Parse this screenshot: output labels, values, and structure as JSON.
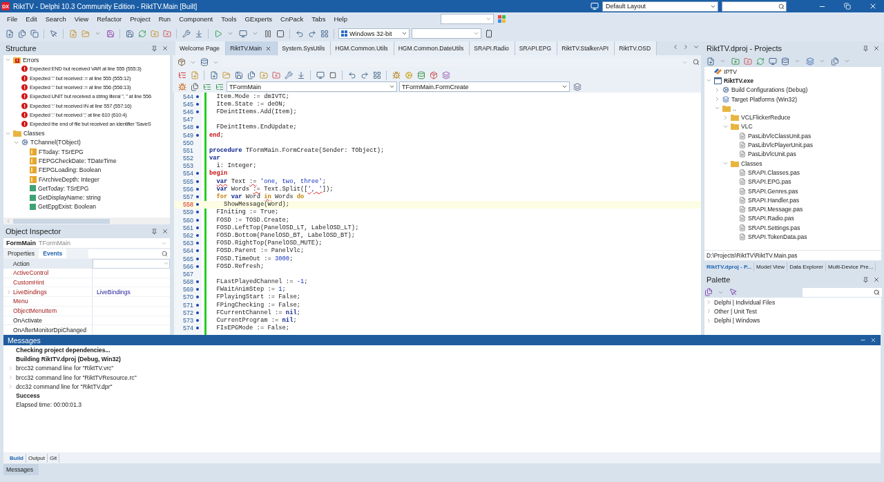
{
  "window": {
    "logo": "DX",
    "title": "RiktTV - Delphi 10.3 Community Edition - RiktTV.Main [Built]",
    "layout": "Default Layout"
  },
  "menu": [
    "File",
    "Edit",
    "Search",
    "View",
    "Refactor",
    "Project",
    "Run",
    "Component",
    "Tools",
    "GExperts",
    "CnPack",
    "Tabs",
    "Help"
  ],
  "toolbar": {
    "platform": "Windows 32-bit"
  },
  "structure": {
    "title": "Structure",
    "tree": [
      {
        "label": "Errors",
        "kind": "error-folder",
        "expanded": true,
        "children": [
          {
            "label": "Expected END but received VAR at line 555 (555:3)",
            "kind": "error"
          },
          {
            "label": "Expected ':' but received := at line 555 (555:12)",
            "kind": "error"
          },
          {
            "label": "Expected ':' but received := at line 556 (556:13)",
            "kind": "error"
          },
          {
            "label": "Expected UNIT but received a string literal '', '' at line 556",
            "kind": "error"
          },
          {
            "label": "Expected ':' but received IN at line 557 (557:16)",
            "kind": "error"
          },
          {
            "label": "Expected '.' but received ';' at line 610 (610:4)",
            "kind": "error"
          },
          {
            "label": "Expected the end of file but received an identifier 'SaveS",
            "kind": "error"
          }
        ]
      },
      {
        "label": "Classes",
        "kind": "folder",
        "expanded": true,
        "children": [
          {
            "label": "TChannel(TObject)",
            "kind": "class",
            "expanded": true,
            "children": [
              {
                "label": "FToday: TSrEPG",
                "kind": "field"
              },
              {
                "label": "FEPGCheckDate: TDateTime",
                "kind": "field"
              },
              {
                "label": "FEPGLoading: Boolean",
                "kind": "field"
              },
              {
                "label": "FArchiveDepth: Integer",
                "kind": "field"
              },
              {
                "label": "GetToday: TSrEPG",
                "kind": "method"
              },
              {
                "label": "GetDisplayName: string",
                "kind": "method"
              },
              {
                "label": "GetEpgExist: Boolean",
                "kind": "method"
              }
            ]
          }
        ]
      }
    ]
  },
  "object_inspector": {
    "title": "Object Inspector",
    "component": "FormMain",
    "class": "TFormMain",
    "tabs": [
      {
        "label": "Properties",
        "selected": false
      },
      {
        "label": "Events",
        "selected": true
      }
    ],
    "rows": [
      {
        "name": "Action",
        "kind": "event",
        "selected": true
      },
      {
        "name": "ActiveControl",
        "kind": "reference",
        "selected": false
      },
      {
        "name": "CustomHint",
        "kind": "reference",
        "selected": false
      },
      {
        "name": "LiveBindings",
        "kind": "reference",
        "selected": false,
        "expanded": false,
        "value": "LiveBindings"
      },
      {
        "name": "Menu",
        "kind": "reference",
        "selected": false
      },
      {
        "name": "ObjectMenuItem",
        "kind": "reference",
        "selected": false
      },
      {
        "name": "OnActivate",
        "kind": "event",
        "selected": false
      },
      {
        "name": "OnAfterMonitorDpiChanged",
        "kind": "event",
        "selected": false
      }
    ]
  },
  "editor": {
    "tabs": [
      {
        "label": "Welcome Page",
        "selected": false
      },
      {
        "label": "RiktTV.Main",
        "selected": true
      },
      {
        "label": "System.SysUtils",
        "selected": false
      },
      {
        "label": "HGM.Common.Utils",
        "selected": false
      },
      {
        "label": "HGM.Common.DateUtils",
        "selected": false
      },
      {
        "label": "SRAPI.Radio",
        "selected": false
      },
      {
        "label": "SRAPI.EPG",
        "selected": false
      },
      {
        "label": "RiktTV.StalkerAPI",
        "selected": false
      },
      {
        "label": "RiktTV.OSD",
        "selected": false
      }
    ],
    "class_combo": "TFormMain",
    "method_combo": "TFormMain.FormCreate",
    "lines": [
      {
        "number": "544",
        "marker": true,
        "current": false,
        "kind": "body",
        "segments": [
          {
            "kind": "plain",
            "text": "Item.Mode := dmIVTC;"
          }
        ]
      },
      {
        "number": "545",
        "marker": true,
        "current": false,
        "kind": "body",
        "segments": [
          {
            "kind": "plain",
            "text": "Item.State := deON;"
          }
        ]
      },
      {
        "number": "546",
        "marker": true,
        "current": false,
        "kind": "body",
        "segments": [
          {
            "kind": "plain",
            "text": "FDeintItems.Add(Item);"
          }
        ]
      },
      {
        "number": "547",
        "marker": false,
        "current": false
      },
      {
        "number": "548",
        "marker": true,
        "current": false,
        "kind": "body",
        "segments": [
          {
            "kind": "plain",
            "text": "FDeintItems.EndUpdate;"
          }
        ]
      },
      {
        "number": "549",
        "marker": true,
        "current": false,
        "kind": "top",
        "segments": [
          {
            "kind": "block",
            "text": "end"
          },
          {
            "kind": "plain",
            "text": ";"
          }
        ]
      },
      {
        "number": "550",
        "marker": false,
        "current": false
      },
      {
        "number": "551",
        "marker": false,
        "current": false,
        "kind": "top",
        "segments": [
          {
            "kind": "keyword",
            "text": "procedure"
          },
          {
            "kind": "plain",
            "text": " TFormMain.FormCreate(Sender: TObject);"
          }
        ]
      },
      {
        "number": "552",
        "marker": false,
        "current": false,
        "kind": "top",
        "segments": [
          {
            "kind": "keyword",
            "text": "var"
          }
        ]
      },
      {
        "number": "553",
        "marker": false,
        "current": false,
        "kind": "body",
        "segments": [
          {
            "kind": "plain",
            "text": "i: Integer;"
          }
        ]
      },
      {
        "number": "554",
        "marker": true,
        "current": false,
        "kind": "top",
        "segments": [
          {
            "kind": "block",
            "text": "begin"
          }
        ]
      },
      {
        "number": "555",
        "marker": true,
        "current": false,
        "kind": "body",
        "segments": [
          {
            "kind": "keyword",
            "text": "var",
            "squiggle": true
          },
          {
            "kind": "plain",
            "text": " Text "
          },
          {
            "kind": "plain",
            "text": ":=",
            "squiggle": true
          },
          {
            "kind": "string",
            "text": " 'one, two, three'"
          },
          {
            "kind": "plain",
            "text": ";"
          }
        ]
      },
      {
        "number": "556",
        "marker": true,
        "current": false,
        "kind": "body",
        "segments": [
          {
            "kind": "keyword",
            "text": "var"
          },
          {
            "kind": "plain",
            "text": " Words "
          },
          {
            "kind": "plain",
            "text": ":=",
            "squiggle": true
          },
          {
            "kind": "plain",
            "text": " Text.Split(["
          },
          {
            "kind": "string",
            "text": "', '",
            "squiggle": true
          },
          {
            "kind": "plain",
            "text": "]);"
          }
        ]
      },
      {
        "number": "557",
        "marker": true,
        "current": false,
        "kind": "body",
        "segments": [
          {
            "kind": "flow",
            "text": "for "
          },
          {
            "kind": "keyword",
            "text": "var"
          },
          {
            "kind": "plain",
            "text": " Word "
          },
          {
            "kind": "flow",
            "text": "in",
            "squiggle": true
          },
          {
            "kind": "plain",
            "text": " Words "
          },
          {
            "kind": "flow",
            "text": "do"
          }
        ]
      },
      {
        "number": "558",
        "marker": true,
        "current": true,
        "kind": "inner",
        "segments": [
          {
            "kind": "plain",
            "text": "ShowMessage(Word);"
          }
        ]
      },
      {
        "number": "559",
        "marker": true,
        "current": false,
        "kind": "body",
        "segments": [
          {
            "kind": "plain",
            "text": "FIniting := True;"
          }
        ]
      },
      {
        "number": "560",
        "marker": true,
        "current": false,
        "kind": "body",
        "segments": [
          {
            "kind": "plain",
            "text": "FOSD := TOSD.Create;"
          }
        ]
      },
      {
        "number": "561",
        "marker": true,
        "current": false,
        "kind": "body",
        "segments": [
          {
            "kind": "plain",
            "text": "FOSD.LeftTop(PanelOSD_LT, LabelOSD_LT);"
          }
        ]
      },
      {
        "number": "562",
        "marker": true,
        "current": false,
        "kind": "body",
        "segments": [
          {
            "kind": "plain",
            "text": "FOSD.Bottom(PanelOSD_BT, LabelOSD_BT);"
          }
        ]
      },
      {
        "number": "563",
        "marker": true,
        "current": false,
        "kind": "body",
        "segments": [
          {
            "kind": "plain",
            "text": "FOSD.RightTop(PanelOSD_MUTE);"
          }
        ]
      },
      {
        "number": "564",
        "marker": true,
        "current": false,
        "kind": "body",
        "segments": [
          {
            "kind": "plain",
            "text": "FOSD.Parent := PanelVlc;"
          }
        ]
      },
      {
        "number": "565",
        "marker": true,
        "current": false,
        "kind": "body",
        "segments": [
          {
            "kind": "plain",
            "text": "FOSD.TimeOut := "
          },
          {
            "kind": "number",
            "text": "3000"
          },
          {
            "kind": "plain",
            "text": ";"
          }
        ]
      },
      {
        "number": "566",
        "marker": true,
        "current": false,
        "kind": "body",
        "segments": [
          {
            "kind": "plain",
            "text": "FOSD.Refresh;"
          }
        ]
      },
      {
        "number": "567",
        "marker": false,
        "current": false
      },
      {
        "number": "568",
        "marker": true,
        "current": false,
        "kind": "body",
        "segments": [
          {
            "kind": "plain",
            "text": "FLastPlayedChannel := "
          },
          {
            "kind": "number",
            "text": "-1"
          },
          {
            "kind": "plain",
            "text": ";"
          }
        ]
      },
      {
        "number": "569",
        "marker": true,
        "current": false,
        "kind": "body",
        "segments": [
          {
            "kind": "plain",
            "text": "FWaitAnimStep := "
          },
          {
            "kind": "number",
            "text": "1"
          },
          {
            "kind": "plain",
            "text": ";"
          }
        ]
      },
      {
        "number": "570",
        "marker": true,
        "current": false,
        "kind": "body",
        "segments": [
          {
            "kind": "plain",
            "text": "FPlayingStart := False;"
          }
        ]
      },
      {
        "number": "571",
        "marker": true,
        "current": false,
        "kind": "body",
        "segments": [
          {
            "kind": "plain",
            "text": "FPingChecking := False;"
          }
        ]
      },
      {
        "number": "572",
        "marker": true,
        "current": false,
        "kind": "body",
        "segments": [
          {
            "kind": "plain",
            "text": "FCurrentChannel := "
          },
          {
            "kind": "keyword",
            "text": "nil"
          },
          {
            "kind": "plain",
            "text": ";"
          }
        ]
      },
      {
        "number": "573",
        "marker": true,
        "current": false,
        "kind": "body",
        "segments": [
          {
            "kind": "plain",
            "text": "CurrentProgram := "
          },
          {
            "kind": "keyword",
            "text": "nil"
          },
          {
            "kind": "plain",
            "text": ";"
          }
        ]
      },
      {
        "number": "574",
        "marker": true,
        "current": false,
        "kind": "body",
        "segments": [
          {
            "kind": "plain",
            "text": "FIsEPGMode := False;"
          }
        ]
      }
    ]
  },
  "projects": {
    "title": "RiktTV.dproj - Projects",
    "tree": [
      {
        "label": "IPTV",
        "kind": "project-group"
      },
      {
        "label": "RiktTV.exe",
        "kind": "exe",
        "expanded": true,
        "children": [
          {
            "label": "Build Configurations (Debug)",
            "kind": "config",
            "expanded": false
          },
          {
            "label": "Target Platforms (Win32)",
            "kind": "platform",
            "expanded": false
          },
          {
            "label": "..",
            "kind": "folder",
            "expanded": true,
            "children": [
              {
                "label": "VCLFlickerReduce",
                "kind": "folder",
                "expanded": false
              },
              {
                "label": "VLC",
                "kind": "folder",
                "expanded": true,
                "children": [
                  {
                    "label": "PasLibVlcClassUnit.pas",
                    "kind": "file"
                  },
                  {
                    "label": "PasLibVlcPlayerUnit.pas",
                    "kind": "file"
                  },
                  {
                    "label": "PasLibVlcUnit.pas",
                    "kind": "file"
                  }
                ]
              },
              {
                "label": "Classes",
                "kind": "folder",
                "expanded": true,
                "children": [
                  {
                    "label": "SRAPI.Classes.pas",
                    "kind": "file"
                  },
                  {
                    "label": "SRAPI.EPG.pas",
                    "kind": "file"
                  },
                  {
                    "label": "SRAPI.Genres.pas",
                    "kind": "file"
                  },
                  {
                    "label": "SRAPI.Handler.pas",
                    "kind": "file"
                  },
                  {
                    "label": "SRAPI.Message.pas",
                    "kind": "file"
                  },
                  {
                    "label": "SRAPI.Radio.pas",
                    "kind": "file"
                  },
                  {
                    "label": "SRAPI.Settings.pas",
                    "kind": "file"
                  },
                  {
                    "label": "SRAPI.TokenData.pas",
                    "kind": "file"
                  }
                ]
              }
            ]
          }
        ]
      }
    ],
    "path": "D:\\Projects\\RiktTV\\RiktTV.Main.pas",
    "tabs": [
      {
        "label": "RiktTV.dproj - P...",
        "selected": true
      },
      {
        "label": "Model View",
        "selected": false
      },
      {
        "label": "Data Explorer",
        "selected": false
      },
      {
        "label": "Multi-Device Pre...",
        "selected": false
      }
    ]
  },
  "palette": {
    "title": "Palette",
    "items": [
      {
        "label": "Delphi | Individual Files",
        "expanded": false
      },
      {
        "label": "Other | Unit Test",
        "expanded": false
      },
      {
        "label": "Delphi | Windows",
        "expanded": false
      }
    ]
  },
  "messages": {
    "title": "Messages",
    "lines": [
      {
        "text": "Checking project dependencies...",
        "kind": "heading"
      },
      {
        "text": "Building RiktTV.dproj (Debug, Win32)",
        "kind": "heading"
      },
      {
        "text": "brcc32 command line for \"RiktTV.vrc\"",
        "kind": "expandable"
      },
      {
        "text": "brcc32 command line for \"RiktTVResource.rc\"",
        "kind": "expandable"
      },
      {
        "text": "dcc32 command line for \"RiktTV.dpr\"",
        "kind": "expandable"
      },
      {
        "text": "Success",
        "kind": "heading"
      },
      {
        "text": "Elapsed time: 00:00:01.3",
        "kind": "plain"
      }
    ],
    "tabs": [
      {
        "label": "Build",
        "selected": true
      },
      {
        "label": "Output",
        "selected": false
      },
      {
        "label": "Git",
        "selected": false
      }
    ],
    "bottom_tab": "Messages"
  }
}
